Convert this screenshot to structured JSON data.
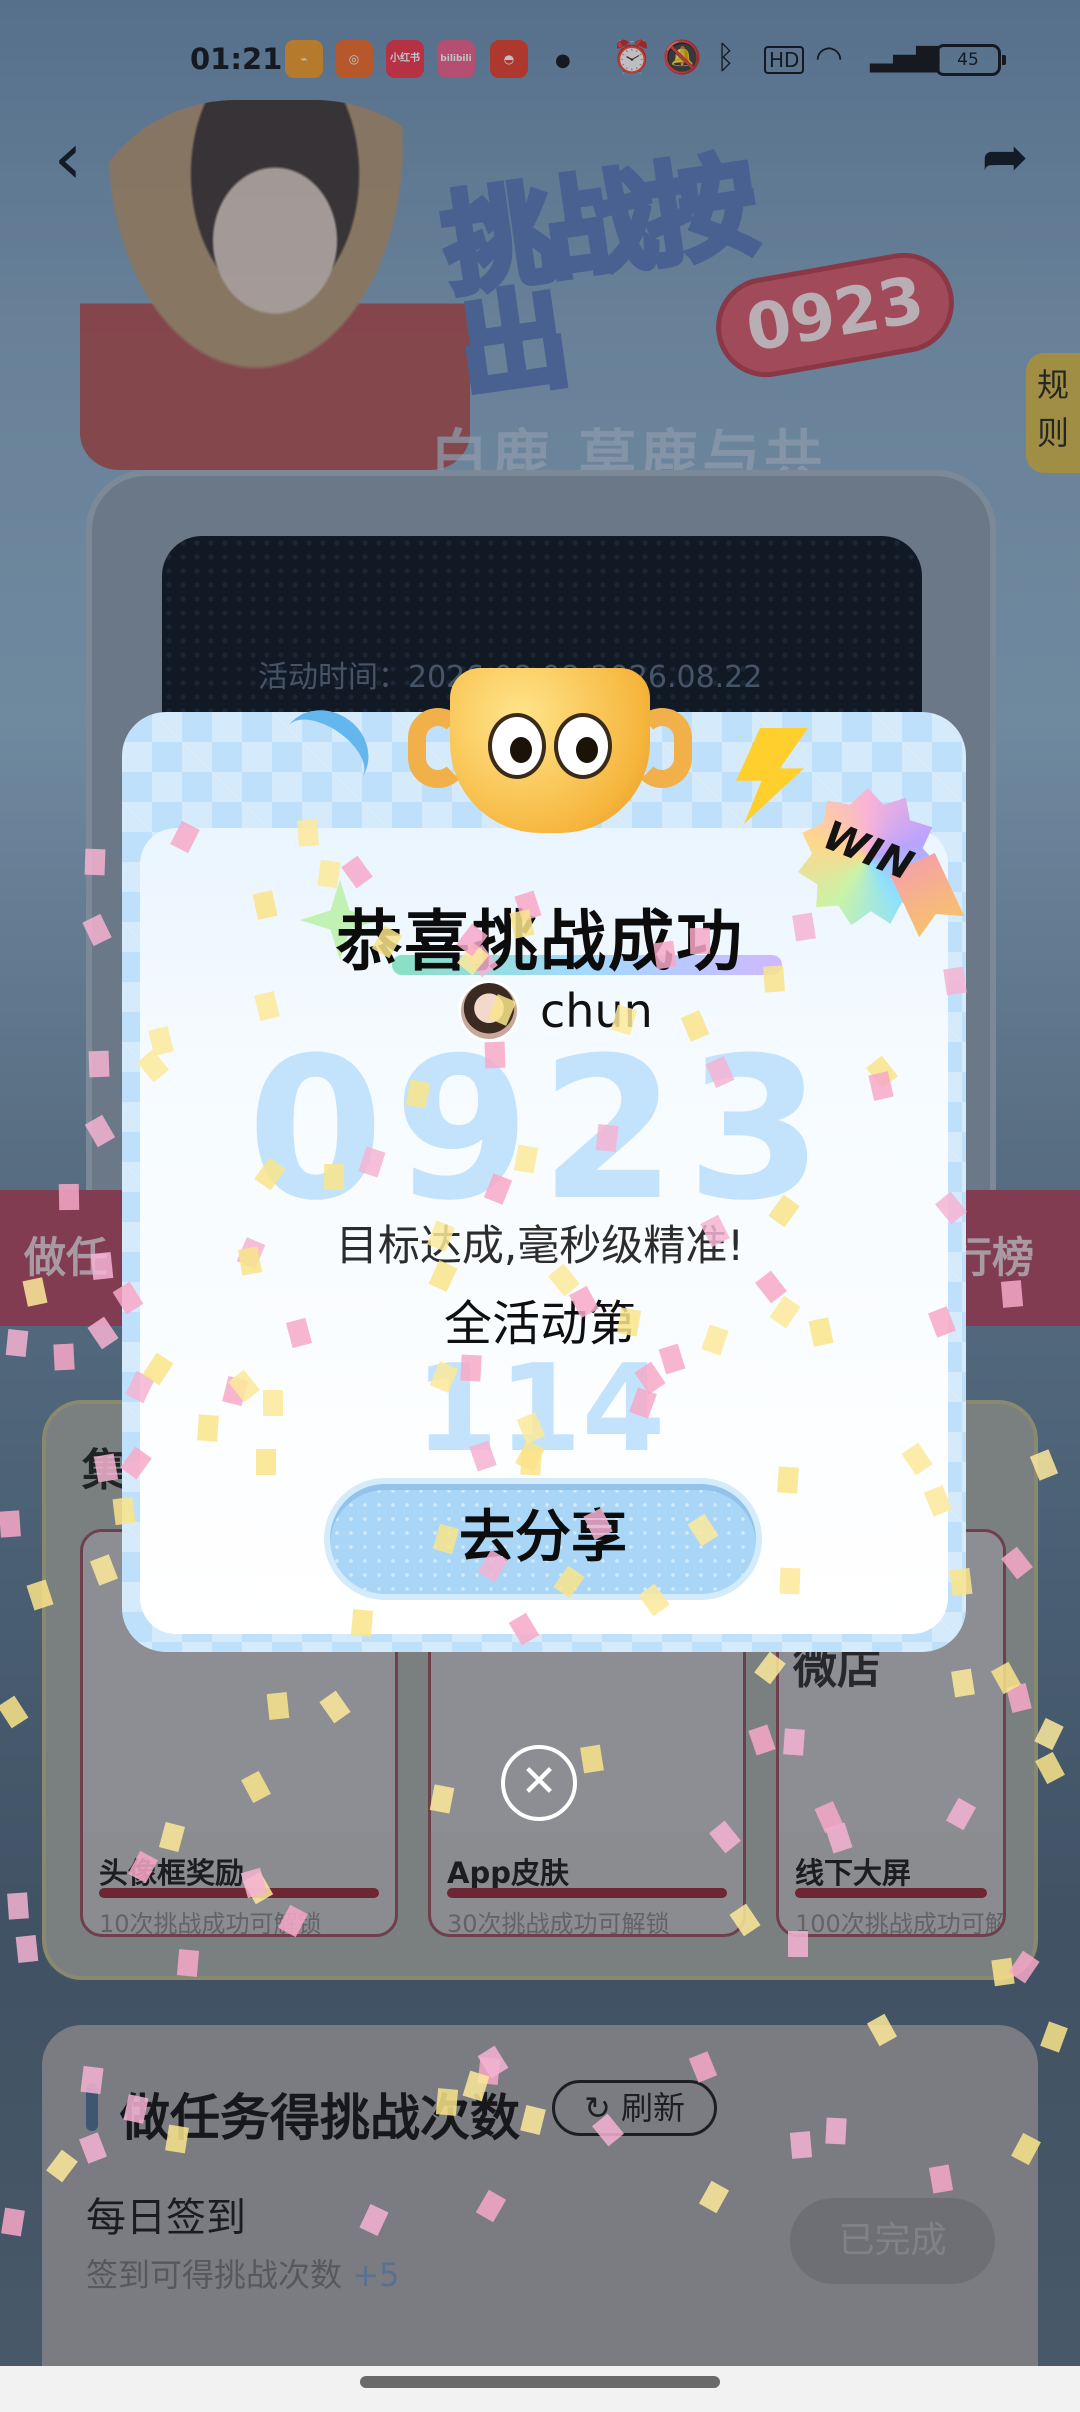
{
  "status_bar": {
    "time": "01:21",
    "apps": [
      {
        "icon": "app-icon-1",
        "label": "",
        "color": "#f19c2c"
      },
      {
        "icon": "app-icon-2",
        "label": "",
        "color": "#f26d2b"
      },
      {
        "icon": "xiaohongshu-icon",
        "label": "小红书",
        "color": "#f0374c"
      },
      {
        "icon": "bilibili-icon",
        "label": "bilibili",
        "color": "#f0608c"
      },
      {
        "icon": "app-icon-5",
        "label": "",
        "color": "#e8412f"
      }
    ],
    "battery": "45"
  },
  "header": {
    "back_icon": "back-arrow-icon",
    "share_icon": "share-icon",
    "title_art": "挑战按出",
    "title_number": "0923",
    "subtitle_art": "白鹿 莫鹿与共",
    "rules_tab": "规则"
  },
  "background": {
    "activity_time": "活动时间：2026.08.08-2026.08.22",
    "left_entry": "做任",
    "right_entry": "行榜",
    "collect_heading": "集",
    "rewards": [
      {
        "name": "头像框奖励",
        "desc": "10次挑战成功可解锁"
      },
      {
        "name": "App皮肤",
        "desc": "30次挑战成功可解锁"
      },
      {
        "name": "线下大屏",
        "desc": "100次挑战成功可解"
      }
    ],
    "shop_logo": "微店",
    "task_section_title": "做任务得挑战次数",
    "refresh_label": "刷新",
    "daily_signin_title": "每日签到",
    "daily_signin_desc": "签到可得挑战次数",
    "daily_signin_reward": "+5",
    "done_label": "已完成"
  },
  "modal": {
    "title": "恭喜挑战成功",
    "username": "chun",
    "score": "0923",
    "target_text": "目标达成,毫秒级精准!",
    "rank_label": "全活动第",
    "rank_number": "114",
    "share_button": "去分享",
    "badge_text": "WIN",
    "close_icon": "close-icon"
  },
  "colors": {
    "modal_bg": "#bfe0fb",
    "score_color": "#c3e2fb",
    "share_button_bg": "#a9d6f6"
  }
}
